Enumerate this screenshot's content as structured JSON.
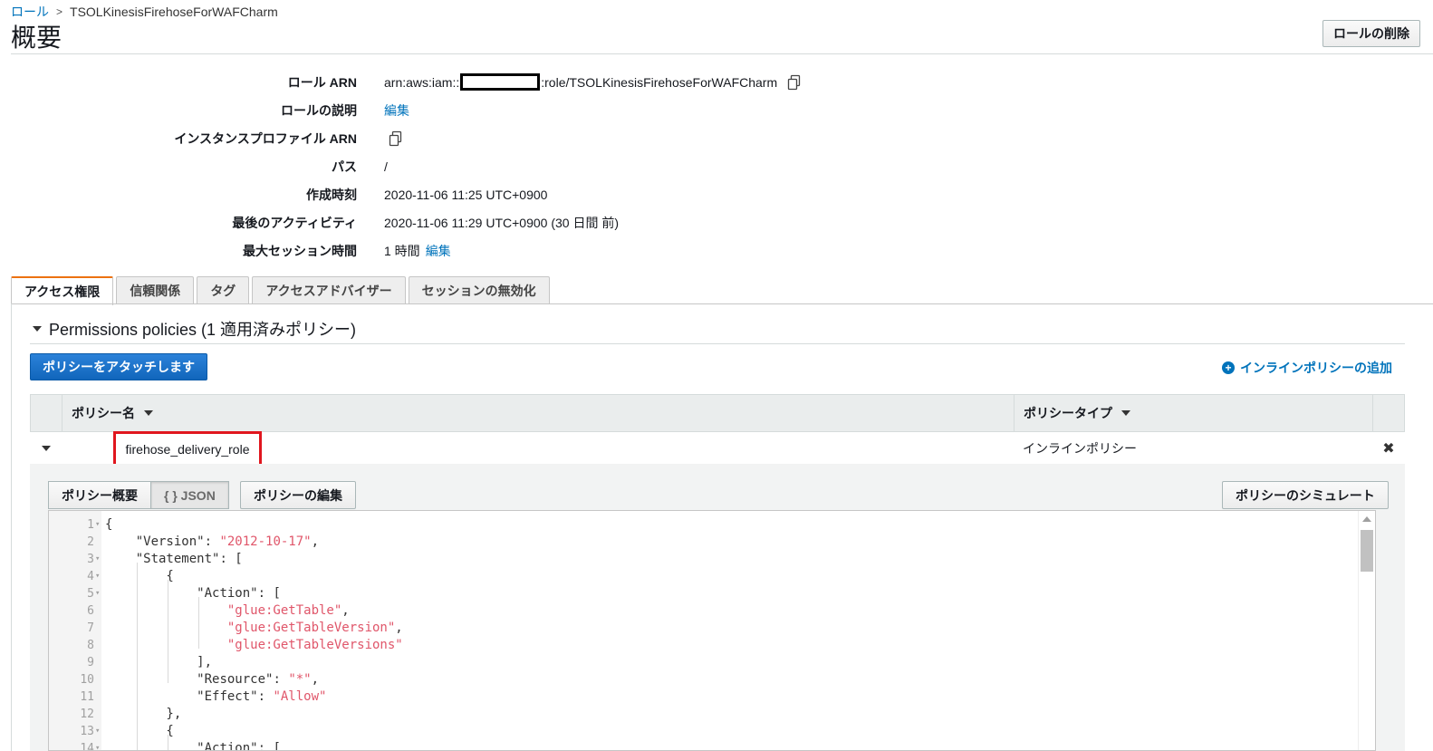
{
  "breadcrumb": {
    "parent": "ロール",
    "current": "TSOLKinesisFirehoseForWAFCharm"
  },
  "header": {
    "title": "概要",
    "delete_label": "ロールの削除"
  },
  "summary": {
    "role_arn_label": "ロール ARN",
    "role_arn_prefix": "arn:aws:iam::",
    "role_arn_suffix": ":role/TSOLKinesisFirehoseForWAFCharm",
    "description_label": "ロールの説明",
    "description_edit": "編集",
    "instance_profile_label": "インスタンスプロファイル ARN",
    "path_label": "パス",
    "path_value": "/",
    "created_label": "作成時刻",
    "created_value": "2020-11-06 11:25 UTC+0900",
    "last_activity_label": "最後のアクティビティ",
    "last_activity_value": "2020-11-06 11:29 UTC+0900 (30 日間 前)",
    "max_session_label": "最大セッション時間",
    "max_session_value": "1 時間",
    "max_session_edit": "編集"
  },
  "tabs": [
    "アクセス権限",
    "信頼関係",
    "タグ",
    "アクセスアドバイザー",
    "セッションの無効化"
  ],
  "permissions": {
    "heading": "Permissions policies (1 適用済みポリシー)",
    "attach_label": "ポリシーをアタッチします",
    "add_inline_label": "インラインポリシーの追加",
    "columns": {
      "name": "ポリシー名",
      "type": "ポリシータイプ"
    },
    "rows": [
      {
        "name": "firehose_delivery_role",
        "type": "インラインポリシー",
        "remove": "✖"
      }
    ],
    "detail": {
      "summary_tab": "ポリシー概要",
      "json_tab": "{ } JSON",
      "edit_label": "ポリシーの編集",
      "simulate_label": "ポリシーのシミュレート"
    }
  },
  "code_lines": [
    {
      "n": "1",
      "fold": true,
      "text": "{"
    },
    {
      "n": "2",
      "fold": false,
      "text": "    \"Version\": \"2012-10-17\","
    },
    {
      "n": "3",
      "fold": true,
      "text": "    \"Statement\": ["
    },
    {
      "n": "4",
      "fold": true,
      "text": "        {"
    },
    {
      "n": "5",
      "fold": true,
      "text": "            \"Action\": ["
    },
    {
      "n": "6",
      "fold": false,
      "text": "                \"glue:GetTable\","
    },
    {
      "n": "7",
      "fold": false,
      "text": "                \"glue:GetTableVersion\","
    },
    {
      "n": "8",
      "fold": false,
      "text": "                \"glue:GetTableVersions\""
    },
    {
      "n": "9",
      "fold": false,
      "text": "            ],"
    },
    {
      "n": "10",
      "fold": false,
      "text": "            \"Resource\": \"*\","
    },
    {
      "n": "11",
      "fold": false,
      "text": "            \"Effect\": \"Allow\""
    },
    {
      "n": "12",
      "fold": false,
      "text": "        },"
    },
    {
      "n": "13",
      "fold": true,
      "text": "        {"
    },
    {
      "n": "14",
      "fold": true,
      "text": "            \"Action\": ["
    }
  ]
}
